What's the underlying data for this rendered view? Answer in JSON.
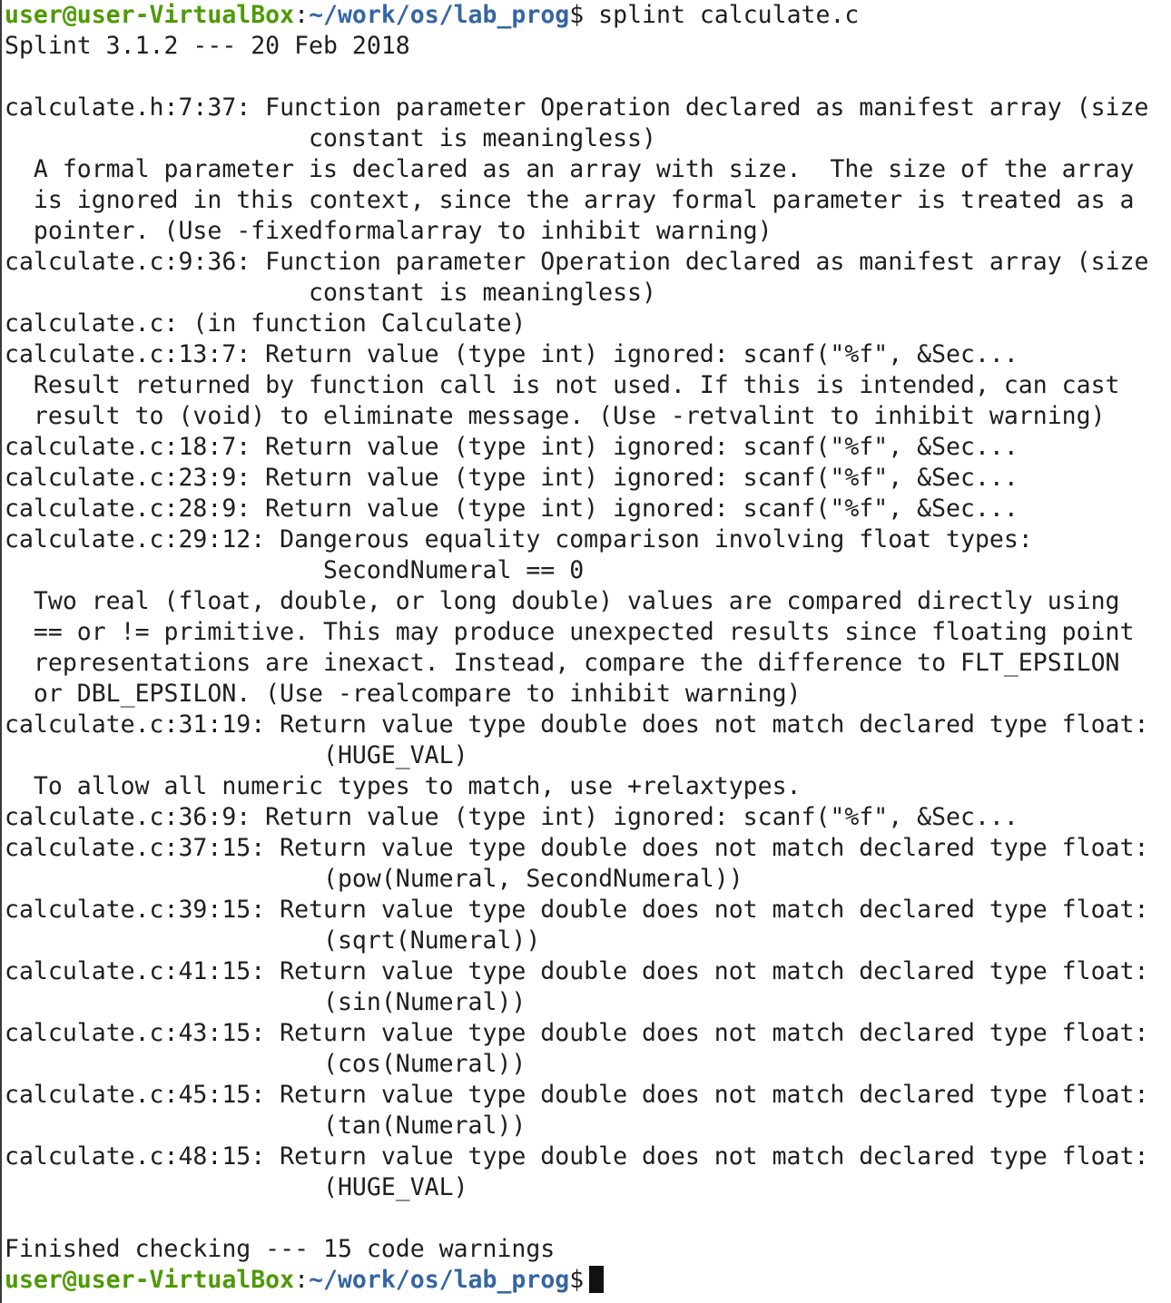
{
  "prompt": {
    "user_host": "user@user-VirtualBox",
    "colon": ":",
    "path": "~/work/os/lab_prog",
    "dollar": "$"
  },
  "command": " splint calculate.c",
  "output": [
    "Splint 3.1.2 --- 20 Feb 2018",
    "",
    "calculate.h:7:37: Function parameter Operation declared as manifest array (size",
    "                     constant is meaningless)",
    "  A formal parameter is declared as an array with size.  The size of the array",
    "  is ignored in this context, since the array formal parameter is treated as a",
    "  pointer. (Use -fixedformalarray to inhibit warning)",
    "calculate.c:9:36: Function parameter Operation declared as manifest array (size",
    "                     constant is meaningless)",
    "calculate.c: (in function Calculate)",
    "calculate.c:13:7: Return value (type int) ignored: scanf(\"%f\", &Sec...",
    "  Result returned by function call is not used. If this is intended, can cast",
    "  result to (void) to eliminate message. (Use -retvalint to inhibit warning)",
    "calculate.c:18:7: Return value (type int) ignored: scanf(\"%f\", &Sec...",
    "calculate.c:23:9: Return value (type int) ignored: scanf(\"%f\", &Sec...",
    "calculate.c:28:9: Return value (type int) ignored: scanf(\"%f\", &Sec...",
    "calculate.c:29:12: Dangerous equality comparison involving float types:",
    "                      SecondNumeral == 0",
    "  Two real (float, double, or long double) values are compared directly using",
    "  == or != primitive. This may produce unexpected results since floating point",
    "  representations are inexact. Instead, compare the difference to FLT_EPSILON",
    "  or DBL_EPSILON. (Use -realcompare to inhibit warning)",
    "calculate.c:31:19: Return value type double does not match declared type float:",
    "                      (HUGE_VAL)",
    "  To allow all numeric types to match, use +relaxtypes.",
    "calculate.c:36:9: Return value (type int) ignored: scanf(\"%f\", &Sec...",
    "calculate.c:37:15: Return value type double does not match declared type float:",
    "                      (pow(Numeral, SecondNumeral))",
    "calculate.c:39:15: Return value type double does not match declared type float:",
    "                      (sqrt(Numeral))",
    "calculate.c:41:15: Return value type double does not match declared type float:",
    "                      (sin(Numeral))",
    "calculate.c:43:15: Return value type double does not match declared type float:",
    "                      (cos(Numeral))",
    "calculate.c:45:15: Return value type double does not match declared type float:",
    "                      (tan(Numeral))",
    "calculate.c:48:15: Return value type double does not match declared type float:",
    "                      (HUGE_VAL)",
    "",
    "Finished checking --- 15 code warnings"
  ],
  "colors": {
    "background": "#ffffff",
    "text": "#1e1e1e",
    "prompt_user": "#4e9a06",
    "prompt_path": "#3465a4"
  }
}
